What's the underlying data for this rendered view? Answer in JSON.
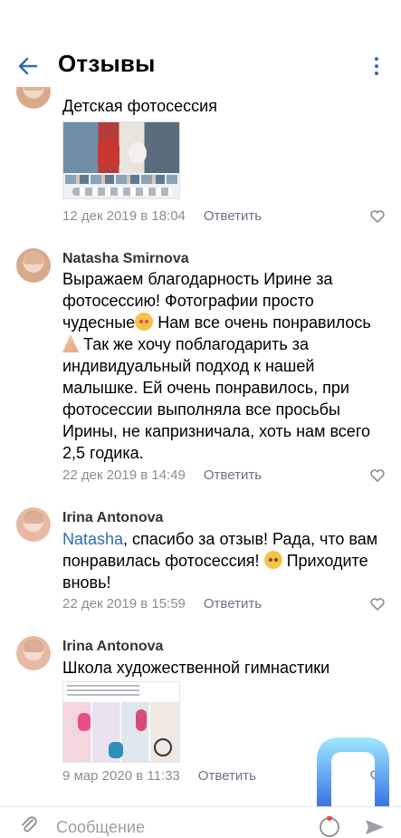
{
  "header": {
    "title": "Отзывы"
  },
  "comments": [
    {
      "text": "Детская фотосессия",
      "date": "12 дек 2019 в 18:04",
      "reply": "Ответить"
    },
    {
      "author": "Natasha Smirnova",
      "text_part1": "Выражаем благодарность Ирине за фотосессию! Фотографии просто чудесные",
      "text_part2": "Нам все очень понравилось",
      "text_part3": "Так же хочу поблагодарить за индивидуальный подход к нашей малышке. Ей очень понравилось, при фотосессии выполняла все просьбы Ирины, не капризничала, хоть нам всего 2,5 годика.",
      "date": "22 дек 2019 в 14:49",
      "reply": "Ответить"
    },
    {
      "author": "Irina Antonova",
      "mention": "Natasha",
      "text": ", спасибо за отзыв! Рада, что вам понравилась фотосессия!",
      "text_end": "Приходите вновь!",
      "date": "22 дек 2019 в 15:59",
      "reply": "Ответить"
    },
    {
      "author": "Irina Antonova",
      "text": "Школа художественной гимнастики",
      "date": "9 мар 2020 в 11:33",
      "reply": "Ответить"
    }
  ],
  "input": {
    "placeholder": "Сообщение"
  },
  "icons": [
    "back-arrow-icon",
    "more-vertical-icon",
    "heart-icon",
    "paperclip-icon",
    "sticker-icon",
    "send-icon"
  ],
  "colors": {
    "accent": "#2a6fb0",
    "muted": "#8a8d92",
    "brand_gradient_top": "#9fe8ff",
    "brand_gradient_bottom": "#1f55e0"
  }
}
